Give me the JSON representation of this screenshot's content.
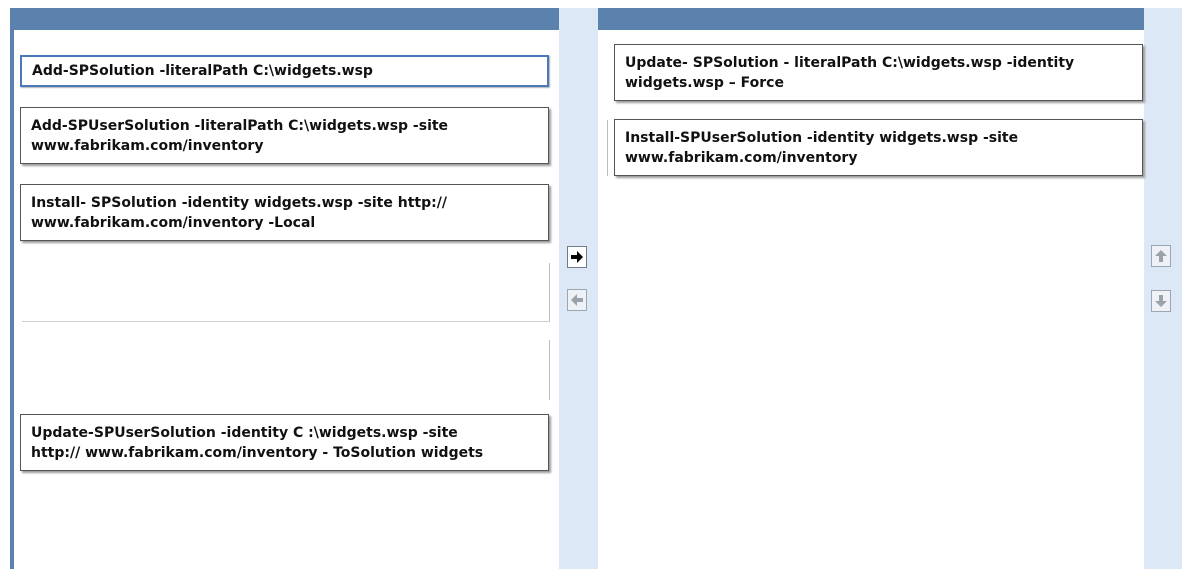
{
  "source_list": {
    "items": [
      {
        "text": "Add-SPSolution -literalPath C:\\widgets.wsp"
      },
      {
        "text": "Add-SPUserSolution -literalPath C:\\widgets.wsp -site\nwww.fabrikam.com/inventory"
      },
      {
        "text": "Install- SPSolution -identity widgets.wsp -site http://\nwww.fabrikam.com/inventory -Local"
      },
      {
        "text": "Update-SPUserSolution -identity C :\\widgets.wsp -site\nhttp:// www.fabrikam.com/inventory - ToSolution widgets"
      }
    ]
  },
  "answer_list": {
    "items": [
      {
        "text": "Update- SPSolution - literalPath C:\\widgets.wsp -identity\nwidgets.wsp – Force"
      },
      {
        "text": "Install-SPUserSolution -identity widgets.wsp -site\nwww.fabrikam.com/inventory"
      }
    ]
  },
  "controls": {
    "move_right_icon": "arrow-right-icon",
    "move_left_icon": "arrow-left-icon",
    "move_up_icon": "arrow-up-icon",
    "move_down_icon": "arrow-down-icon"
  },
  "colors": {
    "header": "#5a82ad",
    "strip": "#dce8f5",
    "selection_border": "#4a78b8"
  }
}
